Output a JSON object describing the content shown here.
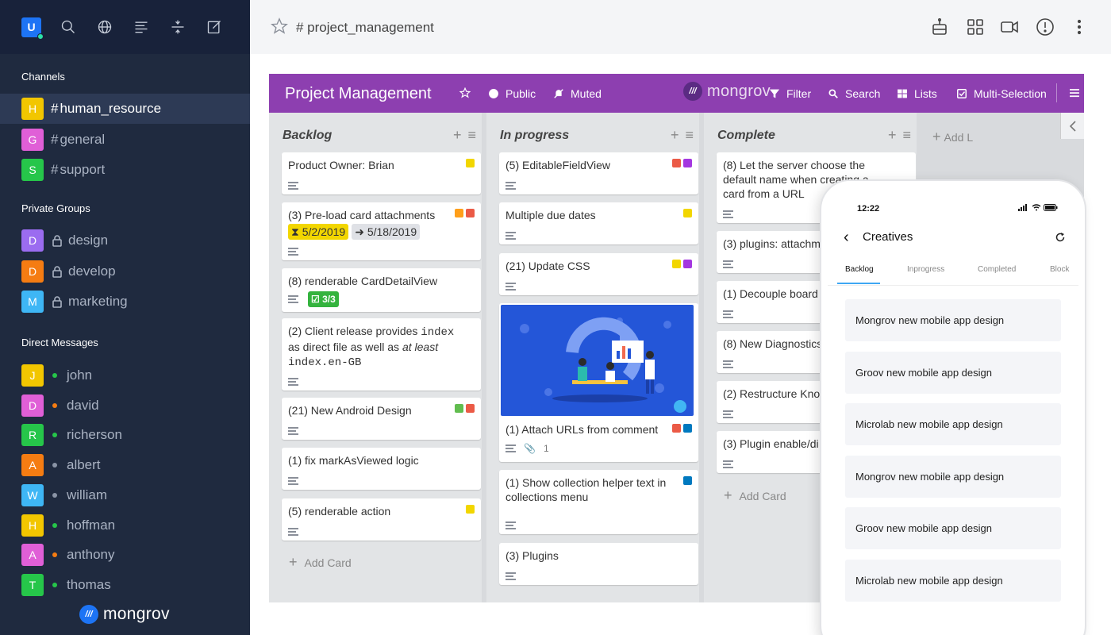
{
  "sidebar": {
    "user_initial": "U",
    "sections": {
      "channels": "Channels",
      "private_groups": "Private Groups",
      "direct_messages": "Direct Messages"
    },
    "channels": [
      {
        "name": "human_resource",
        "initial": "H",
        "color": "#f2c600"
      },
      {
        "name": "general",
        "initial": "G",
        "color": "#e05fd7"
      },
      {
        "name": "support",
        "initial": "S",
        "color": "#26c64a"
      }
    ],
    "groups": [
      {
        "name": "design",
        "initial": "D",
        "color": "#9b6cf0"
      },
      {
        "name": "develop",
        "initial": "D",
        "color": "#f57c12"
      },
      {
        "name": "marketing",
        "initial": "M",
        "color": "#3eb6f5"
      }
    ],
    "dms": [
      {
        "name": "john",
        "initial": "J",
        "color": "#f2c600",
        "status": "#26c64a"
      },
      {
        "name": "david",
        "initial": "D",
        "color": "#e05fd7",
        "status": "#f57c12"
      },
      {
        "name": "richerson",
        "initial": "R",
        "color": "#26c64a",
        "status": "#26c64a"
      },
      {
        "name": "albert",
        "initial": "A",
        "color": "#f57c12",
        "status": "#8a94a6"
      },
      {
        "name": "william",
        "initial": "W",
        "color": "#3eb6f5",
        "status": "#8a94a6"
      },
      {
        "name": "hoffman",
        "initial": "H",
        "color": "#f2c600",
        "status": "#26c64a"
      },
      {
        "name": "anthony",
        "initial": "A",
        "color": "#e05fd7",
        "status": "#f57c12"
      },
      {
        "name": "thomas",
        "initial": "T",
        "color": "#26c64a",
        "status": "#26c64a"
      }
    ],
    "logo_text": "mongrov",
    "logo_mark": "///"
  },
  "header": {
    "channel_name": "# project_management"
  },
  "board": {
    "title": "Project Management",
    "public_label": "Public",
    "muted_label": "Muted",
    "logo_text": "mongrov",
    "logo_mark": "///",
    "filter_label": "Filter",
    "search_label": "Search",
    "lists_label": "Lists",
    "multi_label": "Multi-Selection",
    "add_card": "Add Card",
    "add_list": "Add L",
    "columns": [
      {
        "title": "Backlog",
        "cards": [
          {
            "text": "Product Owner: Brian"
          },
          {
            "text": "(3) Pre-load card attachments",
            "due": "5/2/2019",
            "start": "5/18/2019"
          },
          {
            "text": "(8) renderable CardDetailView",
            "checklist": "3/3"
          },
          {
            "text_a": "(2) Client release provides ",
            "code_a": "index",
            "text_b": " as direct file as well as ",
            "em": "at least",
            "code_b": "index.en-GB"
          },
          {
            "text": "(21) New Android Design"
          },
          {
            "text": "(1) fix markAsViewed logic"
          },
          {
            "text": "(5) renderable action"
          }
        ]
      },
      {
        "title": "In progress",
        "cards": [
          {
            "text": "(5) EditableFieldView"
          },
          {
            "text": "Multiple due dates"
          },
          {
            "text": "(21) Update CSS"
          },
          {
            "text": "(1) Attach URLs from comment",
            "attachments": "1"
          },
          {
            "text": "(1) Show collection helper text in collections menu"
          },
          {
            "text": "(3) Plugins"
          }
        ]
      },
      {
        "title": "Complete",
        "cards": [
          {
            "text": "(8) Let the server choose the default name when creating a card from a URL"
          },
          {
            "text": "(3) plugins: attachm"
          },
          {
            "text": "(1) Decouple board"
          },
          {
            "text": "(8) New Diagnostics"
          },
          {
            "text": "(2) Restructure Know"
          },
          {
            "text": "(3) Plugin enable/di"
          }
        ]
      }
    ],
    "label_colors": {
      "yellow": "#f2d600",
      "orange": "#ff9f1a",
      "red": "#eb5a46",
      "purple": "#c377e0",
      "green": "#61bd4f",
      "blue": "#0079bf"
    }
  },
  "phone": {
    "time": "12:22",
    "title": "Creatives",
    "tabs": [
      "Backlog",
      "Inprogress",
      "Completed",
      "Block"
    ],
    "items": [
      "Mongrov new mobile app design",
      "Groov new mobile app design",
      "Microlab new mobile app design",
      "Mongrov new mobile app design",
      "Groov new mobile app design",
      "Microlab new mobile app design"
    ]
  }
}
